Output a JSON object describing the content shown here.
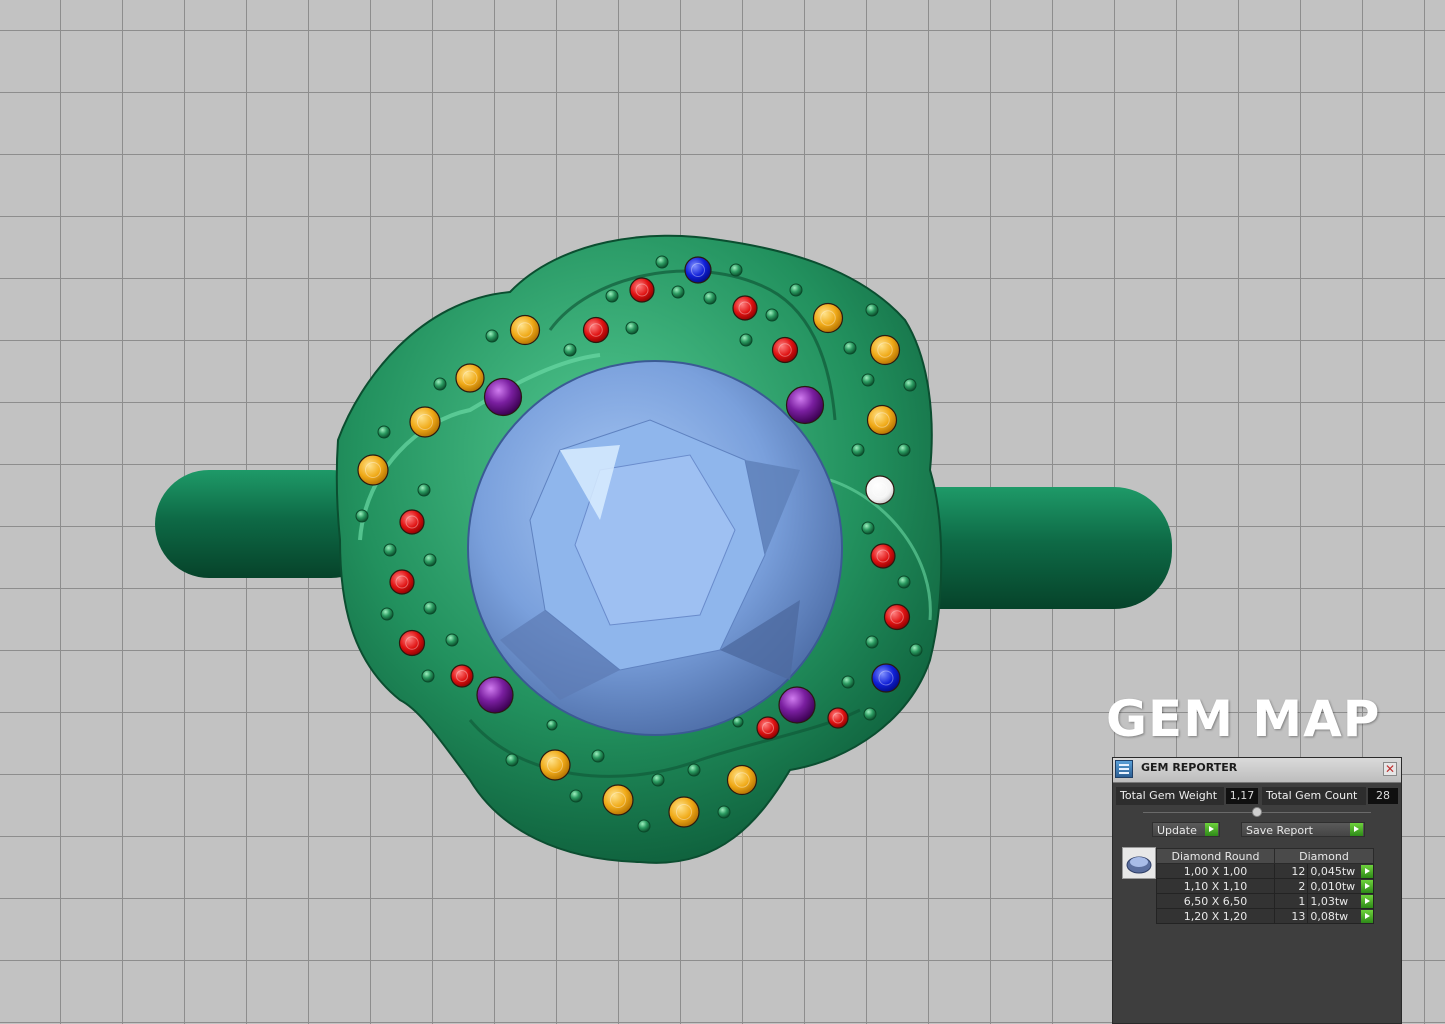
{
  "overlay": {
    "title": "GEM MAP"
  },
  "panel": {
    "title": "GEM REPORTER",
    "total_weight_label": "Total Gem Weight",
    "total_weight_value": "1,17",
    "total_count_label": "Total Gem Count",
    "total_count_value": "28",
    "update_button": "Update",
    "save_report_button": "Save Report",
    "table": {
      "headers": [
        "Diamond Round",
        "Diamond"
      ],
      "rows": [
        {
          "size": "1,00 X 1,00",
          "count": "12",
          "weight": "0,045tw"
        },
        {
          "size": "1,10 X 1,10",
          "count": "2",
          "weight": "0,010tw"
        },
        {
          "size": "6,50 X 6,50",
          "count": "1",
          "weight": "1,03tw"
        },
        {
          "size": "1,20 X 1,20",
          "count": "13",
          "weight": "0,08tw"
        }
      ]
    }
  },
  "colors": {
    "metal": "#1d8a5a",
    "center_stone": "#7ea6e0",
    "gem_yellow": "#f2b020",
    "gem_red": "#e01818",
    "gem_blue": "#1030d8",
    "gem_purple": "#7a1fa0",
    "gem_white": "#ffffff"
  }
}
